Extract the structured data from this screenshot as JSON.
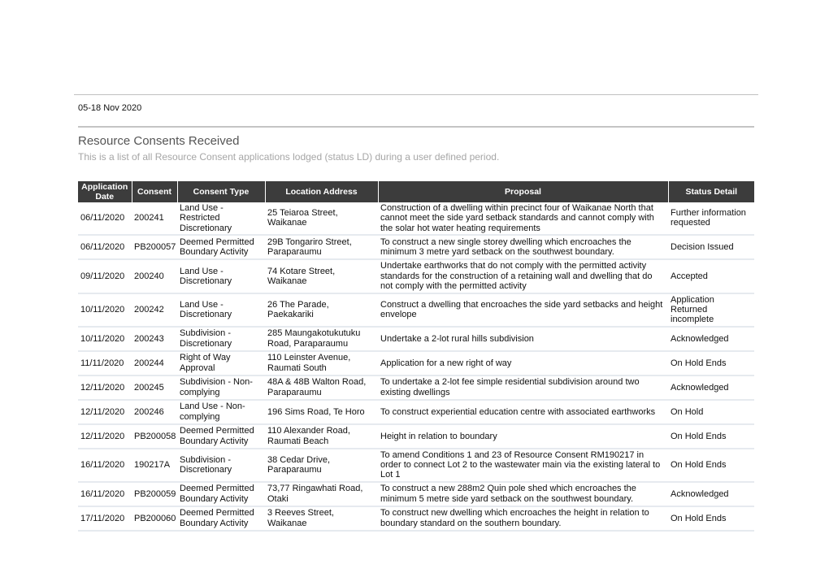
{
  "header": {
    "date_range": "05-18 Nov 2020"
  },
  "report": {
    "title": "Resource Consents Received",
    "subtitle": "This is a list of all Resource Consent applications lodged (status LD) during a user defined period."
  },
  "colors": {
    "header_bg": "#3c3c3c",
    "header_text": "#ffffff",
    "row_divider": "#e6eaef",
    "title_text": "#555555",
    "subtitle_text": "#a6a6a6"
  },
  "table": {
    "columns": [
      "Application Date",
      "Consent",
      "Consent Type",
      "Location Address",
      "Proposal",
      "Status Detail"
    ],
    "rows": [
      {
        "date": "06/11/2020",
        "consent": "200241",
        "type": "Land Use - Restricted Discretionary",
        "location": "25 Teiaroa Street, Waikanae",
        "proposal": "Construction of a dwelling within precinct four of Waikanae North that cannot meet the side yard setback standards and cannot comply with the solar hot water heating requirements",
        "status": "Further information requested"
      },
      {
        "date": "06/11/2020",
        "consent": "PB200057",
        "type": "Deemed Permitted Boundary Activity",
        "location": "29B Tongariro Street, Paraparaumu",
        "proposal": "To construct a new single storey dwelling which encroaches the minimum 3 metre yard setback on the southwest boundary.",
        "status": "Decision Issued"
      },
      {
        "date": "09/11/2020",
        "consent": "200240",
        "type": "Land Use - Discretionary",
        "location": "74 Kotare Street, Waikanae",
        "proposal": "Undertake earthworks that do not comply with the permitted activity standards for the construction of a retaining wall and dwelling that do not comply with the permitted activity",
        "status": "Accepted"
      },
      {
        "date": "10/11/2020",
        "consent": "200242",
        "type": "Land Use - Discretionary",
        "location": "26 The Parade, Paekakariki",
        "proposal": "Construct a dwelling that encroaches the side yard setbacks and height envelope",
        "status": "Application Returned incomplete"
      },
      {
        "date": "10/11/2020",
        "consent": "200243",
        "type": "Subdivision - Discretionary",
        "location": "285 Maungakotukutuku Road, Paraparaumu",
        "proposal": "Undertake a 2-lot rural hills subdivision",
        "status": "Acknowledged"
      },
      {
        "date": "11/11/2020",
        "consent": "200244",
        "type": "Right of Way Approval",
        "location": "110 Leinster Avenue, Raumati South",
        "proposal": "Application for a new right of way",
        "status": "On Hold Ends"
      },
      {
        "date": "12/11/2020",
        "consent": "200245",
        "type": "Subdivision - Non-complying",
        "location": "48A & 48B Walton Road, Paraparaumu",
        "proposal": "To undertake a 2-lot fee simple residential subdivision around two existing dwellings",
        "status": "Acknowledged"
      },
      {
        "date": "12/11/2020",
        "consent": "200246",
        "type": "Land Use - Non-complying",
        "location": "196 Sims Road, Te Horo",
        "proposal": "To construct experiential education centre with associated earthworks",
        "status": "On Hold"
      },
      {
        "date": "12/11/2020",
        "consent": "PB200058",
        "type": "Deemed Permitted Boundary Activity",
        "location": "110 Alexander Road, Raumati Beach",
        "proposal": "Height in relation to boundary",
        "status": "On Hold Ends"
      },
      {
        "date": "16/11/2020",
        "consent": "190217A",
        "type": "Subdivision - Discretionary",
        "location": "38 Cedar Drive, Paraparaumu",
        "proposal": "To amend Conditions 1 and 23 of Resource Consent RM190217 in order to connect Lot 2 to the wastewater main via the existing lateral to Lot 1",
        "status": "On Hold Ends"
      },
      {
        "date": "16/11/2020",
        "consent": "PB200059",
        "type": "Deemed Permitted Boundary Activity",
        "location": "73,77 Ringawhati Road, Otaki",
        "proposal": "To construct a new 288m2 Quin pole shed which encroaches the minimum 5 metre side yard setback on the southwest boundary.",
        "status": "Acknowledged"
      },
      {
        "date": "17/11/2020",
        "consent": "PB200060",
        "type": "Deemed Permitted Boundary Activity",
        "location": "3 Reeves Street, Waikanae",
        "proposal": "To construct new dwelling which encroaches the height in relation to boundary standard on the southern boundary.",
        "status": "On Hold Ends"
      }
    ]
  }
}
